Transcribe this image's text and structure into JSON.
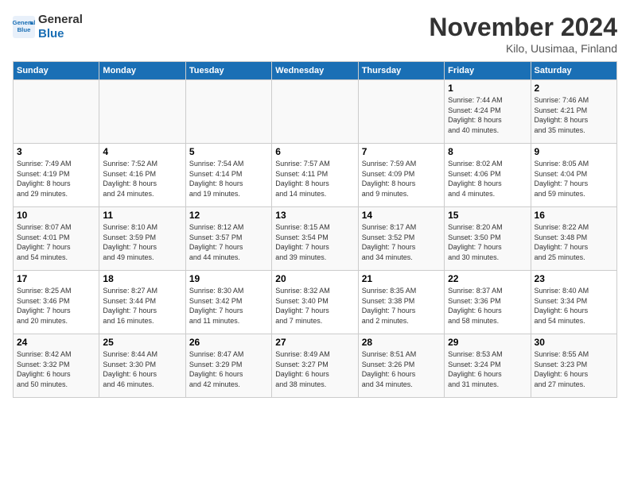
{
  "logo": {
    "line1": "General",
    "line2": "Blue"
  },
  "title": "November 2024",
  "location": "Kilo, Uusimaa, Finland",
  "weekdays": [
    "Sunday",
    "Monday",
    "Tuesday",
    "Wednesday",
    "Thursday",
    "Friday",
    "Saturday"
  ],
  "weeks": [
    [
      {
        "day": "",
        "info": ""
      },
      {
        "day": "",
        "info": ""
      },
      {
        "day": "",
        "info": ""
      },
      {
        "day": "",
        "info": ""
      },
      {
        "day": "",
        "info": ""
      },
      {
        "day": "1",
        "info": "Sunrise: 7:44 AM\nSunset: 4:24 PM\nDaylight: 8 hours\nand 40 minutes."
      },
      {
        "day": "2",
        "info": "Sunrise: 7:46 AM\nSunset: 4:21 PM\nDaylight: 8 hours\nand 35 minutes."
      }
    ],
    [
      {
        "day": "3",
        "info": "Sunrise: 7:49 AM\nSunset: 4:19 PM\nDaylight: 8 hours\nand 29 minutes."
      },
      {
        "day": "4",
        "info": "Sunrise: 7:52 AM\nSunset: 4:16 PM\nDaylight: 8 hours\nand 24 minutes."
      },
      {
        "day": "5",
        "info": "Sunrise: 7:54 AM\nSunset: 4:14 PM\nDaylight: 8 hours\nand 19 minutes."
      },
      {
        "day": "6",
        "info": "Sunrise: 7:57 AM\nSunset: 4:11 PM\nDaylight: 8 hours\nand 14 minutes."
      },
      {
        "day": "7",
        "info": "Sunrise: 7:59 AM\nSunset: 4:09 PM\nDaylight: 8 hours\nand 9 minutes."
      },
      {
        "day": "8",
        "info": "Sunrise: 8:02 AM\nSunset: 4:06 PM\nDaylight: 8 hours\nand 4 minutes."
      },
      {
        "day": "9",
        "info": "Sunrise: 8:05 AM\nSunset: 4:04 PM\nDaylight: 7 hours\nand 59 minutes."
      }
    ],
    [
      {
        "day": "10",
        "info": "Sunrise: 8:07 AM\nSunset: 4:01 PM\nDaylight: 7 hours\nand 54 minutes."
      },
      {
        "day": "11",
        "info": "Sunrise: 8:10 AM\nSunset: 3:59 PM\nDaylight: 7 hours\nand 49 minutes."
      },
      {
        "day": "12",
        "info": "Sunrise: 8:12 AM\nSunset: 3:57 PM\nDaylight: 7 hours\nand 44 minutes."
      },
      {
        "day": "13",
        "info": "Sunrise: 8:15 AM\nSunset: 3:54 PM\nDaylight: 7 hours\nand 39 minutes."
      },
      {
        "day": "14",
        "info": "Sunrise: 8:17 AM\nSunset: 3:52 PM\nDaylight: 7 hours\nand 34 minutes."
      },
      {
        "day": "15",
        "info": "Sunrise: 8:20 AM\nSunset: 3:50 PM\nDaylight: 7 hours\nand 30 minutes."
      },
      {
        "day": "16",
        "info": "Sunrise: 8:22 AM\nSunset: 3:48 PM\nDaylight: 7 hours\nand 25 minutes."
      }
    ],
    [
      {
        "day": "17",
        "info": "Sunrise: 8:25 AM\nSunset: 3:46 PM\nDaylight: 7 hours\nand 20 minutes."
      },
      {
        "day": "18",
        "info": "Sunrise: 8:27 AM\nSunset: 3:44 PM\nDaylight: 7 hours\nand 16 minutes."
      },
      {
        "day": "19",
        "info": "Sunrise: 8:30 AM\nSunset: 3:42 PM\nDaylight: 7 hours\nand 11 minutes."
      },
      {
        "day": "20",
        "info": "Sunrise: 8:32 AM\nSunset: 3:40 PM\nDaylight: 7 hours\nand 7 minutes."
      },
      {
        "day": "21",
        "info": "Sunrise: 8:35 AM\nSunset: 3:38 PM\nDaylight: 7 hours\nand 2 minutes."
      },
      {
        "day": "22",
        "info": "Sunrise: 8:37 AM\nSunset: 3:36 PM\nDaylight: 6 hours\nand 58 minutes."
      },
      {
        "day": "23",
        "info": "Sunrise: 8:40 AM\nSunset: 3:34 PM\nDaylight: 6 hours\nand 54 minutes."
      }
    ],
    [
      {
        "day": "24",
        "info": "Sunrise: 8:42 AM\nSunset: 3:32 PM\nDaylight: 6 hours\nand 50 minutes."
      },
      {
        "day": "25",
        "info": "Sunrise: 8:44 AM\nSunset: 3:30 PM\nDaylight: 6 hours\nand 46 minutes."
      },
      {
        "day": "26",
        "info": "Sunrise: 8:47 AM\nSunset: 3:29 PM\nDaylight: 6 hours\nand 42 minutes."
      },
      {
        "day": "27",
        "info": "Sunrise: 8:49 AM\nSunset: 3:27 PM\nDaylight: 6 hours\nand 38 minutes."
      },
      {
        "day": "28",
        "info": "Sunrise: 8:51 AM\nSunset: 3:26 PM\nDaylight: 6 hours\nand 34 minutes."
      },
      {
        "day": "29",
        "info": "Sunrise: 8:53 AM\nSunset: 3:24 PM\nDaylight: 6 hours\nand 31 minutes."
      },
      {
        "day": "30",
        "info": "Sunrise: 8:55 AM\nSunset: 3:23 PM\nDaylight: 6 hours\nand 27 minutes."
      }
    ]
  ]
}
